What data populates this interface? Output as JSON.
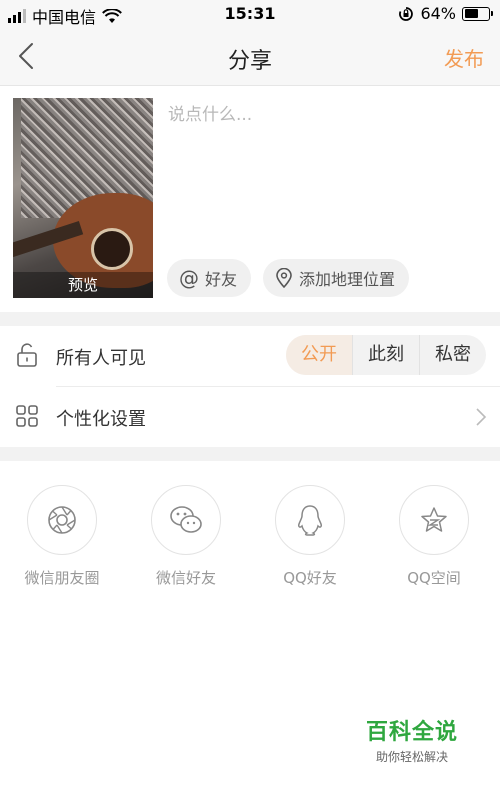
{
  "status_bar": {
    "carrier": "中国电信",
    "time": "15:31",
    "battery_text": "64%",
    "battery_level": 0.64,
    "signal_bars": 3
  },
  "nav": {
    "title": "分享",
    "publish_label": "发布"
  },
  "compose": {
    "preview_label": "预览",
    "text_placeholder": "说点什么...",
    "mention_label": "好友",
    "location_label": "添加地理位置"
  },
  "visibility": {
    "label": "所有人可见",
    "options": [
      "公开",
      "此刻",
      "私密"
    ],
    "selected": "公开"
  },
  "customize": {
    "label": "个性化设置"
  },
  "share_targets": [
    {
      "label": "微信朋友圈",
      "icon": "wechat-moments-icon"
    },
    {
      "label": "微信好友",
      "icon": "wechat-icon"
    },
    {
      "label": "QQ好友",
      "icon": "qq-icon"
    },
    {
      "label": "QQ空间",
      "icon": "qzone-icon"
    }
  ],
  "watermark": {
    "title": "百科全说",
    "subtitle": "助你轻松解决"
  },
  "colors": {
    "accent": "#f29b54",
    "watermark": "#2fa73f"
  }
}
